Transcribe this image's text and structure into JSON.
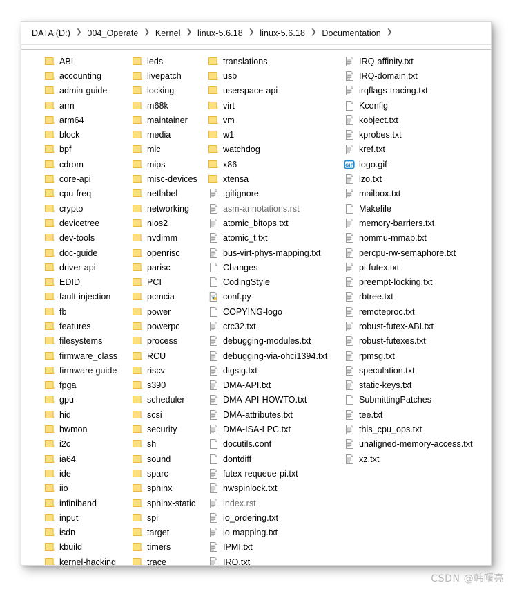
{
  "window": {
    "breadcrumb_separator": "❯",
    "breadcrumb": [
      "DATA (D:)",
      "004_Operate",
      "Kernel",
      "linux-5.6.18",
      "linux-5.6.18",
      "Documentation"
    ]
  },
  "colors": {
    "folder_fill": "#fcdf7f",
    "folder_edge": "#e8b93a",
    "doc_fill": "#ffffff",
    "doc_edge": "#9a9a9a",
    "txt_line": "#8f8f8f",
    "gif_blue": "#1a8ad4",
    "python_blue": "#3b6e9e",
    "python_yellow": "#f4c430",
    "watermark": "#b8b8b8",
    "text": "#000000",
    "dim_text": "#6e6e6e"
  },
  "columns": [
    {
      "id": "col-1",
      "items": [
        {
          "name": "ABI",
          "icon": "folder-icon"
        },
        {
          "name": "accounting",
          "icon": "folder-icon"
        },
        {
          "name": "admin-guide",
          "icon": "folder-icon"
        },
        {
          "name": "arm",
          "icon": "folder-icon"
        },
        {
          "name": "arm64",
          "icon": "folder-icon"
        },
        {
          "name": "block",
          "icon": "folder-icon"
        },
        {
          "name": "bpf",
          "icon": "folder-icon"
        },
        {
          "name": "cdrom",
          "icon": "folder-icon"
        },
        {
          "name": "core-api",
          "icon": "folder-icon"
        },
        {
          "name": "cpu-freq",
          "icon": "folder-icon"
        },
        {
          "name": "crypto",
          "icon": "folder-icon"
        },
        {
          "name": "devicetree",
          "icon": "folder-icon"
        },
        {
          "name": "dev-tools",
          "icon": "folder-icon"
        },
        {
          "name": "doc-guide",
          "icon": "folder-icon"
        },
        {
          "name": "driver-api",
          "icon": "folder-icon"
        },
        {
          "name": "EDID",
          "icon": "folder-icon"
        },
        {
          "name": "fault-injection",
          "icon": "folder-icon"
        },
        {
          "name": "fb",
          "icon": "folder-icon"
        },
        {
          "name": "features",
          "icon": "folder-icon"
        },
        {
          "name": "filesystems",
          "icon": "folder-icon"
        },
        {
          "name": "firmware_class",
          "icon": "folder-icon"
        },
        {
          "name": "firmware-guide",
          "icon": "folder-icon"
        },
        {
          "name": "fpga",
          "icon": "folder-icon"
        },
        {
          "name": "gpu",
          "icon": "folder-icon"
        },
        {
          "name": "hid",
          "icon": "folder-icon"
        },
        {
          "name": "hwmon",
          "icon": "folder-icon"
        },
        {
          "name": "i2c",
          "icon": "folder-icon"
        },
        {
          "name": "ia64",
          "icon": "folder-icon"
        },
        {
          "name": "ide",
          "icon": "folder-icon"
        },
        {
          "name": "iio",
          "icon": "folder-icon"
        },
        {
          "name": "infiniband",
          "icon": "folder-icon"
        },
        {
          "name": "input",
          "icon": "folder-icon"
        },
        {
          "name": "isdn",
          "icon": "folder-icon"
        },
        {
          "name": "kbuild",
          "icon": "folder-icon"
        },
        {
          "name": "kernel-hacking",
          "icon": "folder-icon"
        }
      ]
    },
    {
      "id": "col-2",
      "items": [
        {
          "name": "leds",
          "icon": "folder-icon"
        },
        {
          "name": "livepatch",
          "icon": "folder-icon"
        },
        {
          "name": "locking",
          "icon": "folder-icon"
        },
        {
          "name": "m68k",
          "icon": "folder-icon"
        },
        {
          "name": "maintainer",
          "icon": "folder-icon"
        },
        {
          "name": "media",
          "icon": "folder-icon"
        },
        {
          "name": "mic",
          "icon": "folder-icon"
        },
        {
          "name": "mips",
          "icon": "folder-icon"
        },
        {
          "name": "misc-devices",
          "icon": "folder-icon"
        },
        {
          "name": "netlabel",
          "icon": "folder-icon"
        },
        {
          "name": "networking",
          "icon": "folder-icon"
        },
        {
          "name": "nios2",
          "icon": "folder-icon"
        },
        {
          "name": "nvdimm",
          "icon": "folder-icon"
        },
        {
          "name": "openrisc",
          "icon": "folder-icon"
        },
        {
          "name": "parisc",
          "icon": "folder-icon"
        },
        {
          "name": "PCI",
          "icon": "folder-icon"
        },
        {
          "name": "pcmcia",
          "icon": "folder-icon"
        },
        {
          "name": "power",
          "icon": "folder-icon"
        },
        {
          "name": "powerpc",
          "icon": "folder-icon"
        },
        {
          "name": "process",
          "icon": "folder-icon"
        },
        {
          "name": "RCU",
          "icon": "folder-icon"
        },
        {
          "name": "riscv",
          "icon": "folder-icon"
        },
        {
          "name": "s390",
          "icon": "folder-icon"
        },
        {
          "name": "scheduler",
          "icon": "folder-icon"
        },
        {
          "name": "scsi",
          "icon": "folder-icon"
        },
        {
          "name": "security",
          "icon": "folder-icon"
        },
        {
          "name": "sh",
          "icon": "folder-icon"
        },
        {
          "name": "sound",
          "icon": "folder-icon"
        },
        {
          "name": "sparc",
          "icon": "folder-icon"
        },
        {
          "name": "sphinx",
          "icon": "folder-icon"
        },
        {
          "name": "sphinx-static",
          "icon": "folder-icon"
        },
        {
          "name": "spi",
          "icon": "folder-icon"
        },
        {
          "name": "target",
          "icon": "folder-icon"
        },
        {
          "name": "timers",
          "icon": "folder-icon"
        },
        {
          "name": "trace",
          "icon": "folder-icon"
        }
      ]
    },
    {
      "id": "col-3",
      "items": [
        {
          "name": "translations",
          "icon": "folder-icon"
        },
        {
          "name": "usb",
          "icon": "folder-icon"
        },
        {
          "name": "userspace-api",
          "icon": "folder-icon"
        },
        {
          "name": "virt",
          "icon": "folder-icon"
        },
        {
          "name": "vm",
          "icon": "folder-icon"
        },
        {
          "name": "w1",
          "icon": "folder-icon"
        },
        {
          "name": "watchdog",
          "icon": "folder-icon"
        },
        {
          "name": "x86",
          "icon": "folder-icon"
        },
        {
          "name": "xtensa",
          "icon": "folder-icon"
        },
        {
          "name": ".gitignore",
          "icon": "text-file-icon"
        },
        {
          "name": "asm-annotations.rst",
          "icon": "text-file-icon",
          "dim": true
        },
        {
          "name": "atomic_bitops.txt",
          "icon": "text-file-icon"
        },
        {
          "name": "atomic_t.txt",
          "icon": "text-file-icon"
        },
        {
          "name": "bus-virt-phys-mapping.txt",
          "icon": "text-file-icon"
        },
        {
          "name": "Changes",
          "icon": "blank-file-icon"
        },
        {
          "name": "CodingStyle",
          "icon": "blank-file-icon"
        },
        {
          "name": "conf.py",
          "icon": "python-file-icon"
        },
        {
          "name": "COPYING-logo",
          "icon": "blank-file-icon"
        },
        {
          "name": "crc32.txt",
          "icon": "text-file-icon"
        },
        {
          "name": "debugging-modules.txt",
          "icon": "text-file-icon"
        },
        {
          "name": "debugging-via-ohci1394.txt",
          "icon": "text-file-icon"
        },
        {
          "name": "digsig.txt",
          "icon": "text-file-icon"
        },
        {
          "name": "DMA-API.txt",
          "icon": "text-file-icon"
        },
        {
          "name": "DMA-API-HOWTO.txt",
          "icon": "text-file-icon"
        },
        {
          "name": "DMA-attributes.txt",
          "icon": "text-file-icon"
        },
        {
          "name": "DMA-ISA-LPC.txt",
          "icon": "text-file-icon"
        },
        {
          "name": "docutils.conf",
          "icon": "blank-file-icon"
        },
        {
          "name": "dontdiff",
          "icon": "blank-file-icon"
        },
        {
          "name": "futex-requeue-pi.txt",
          "icon": "text-file-icon"
        },
        {
          "name": "hwspinlock.txt",
          "icon": "text-file-icon"
        },
        {
          "name": "index.rst",
          "icon": "text-file-icon",
          "dim": true
        },
        {
          "name": "io_ordering.txt",
          "icon": "text-file-icon"
        },
        {
          "name": "io-mapping.txt",
          "icon": "text-file-icon"
        },
        {
          "name": "IPMI.txt",
          "icon": "text-file-icon"
        },
        {
          "name": "IRQ.txt",
          "icon": "text-file-icon"
        }
      ]
    },
    {
      "id": "col-4",
      "items": [
        {
          "name": "IRQ-affinity.txt",
          "icon": "text-file-icon"
        },
        {
          "name": "IRQ-domain.txt",
          "icon": "text-file-icon"
        },
        {
          "name": "irqflags-tracing.txt",
          "icon": "text-file-icon"
        },
        {
          "name": "Kconfig",
          "icon": "blank-file-icon"
        },
        {
          "name": "kobject.txt",
          "icon": "text-file-icon"
        },
        {
          "name": "kprobes.txt",
          "icon": "text-file-icon"
        },
        {
          "name": "kref.txt",
          "icon": "text-file-icon"
        },
        {
          "name": "logo.gif",
          "icon": "gif-file-icon"
        },
        {
          "name": "lzo.txt",
          "icon": "text-file-icon"
        },
        {
          "name": "mailbox.txt",
          "icon": "text-file-icon"
        },
        {
          "name": "Makefile",
          "icon": "blank-file-icon"
        },
        {
          "name": "memory-barriers.txt",
          "icon": "text-file-icon"
        },
        {
          "name": "nommu-mmap.txt",
          "icon": "text-file-icon"
        },
        {
          "name": "percpu-rw-semaphore.txt",
          "icon": "text-file-icon"
        },
        {
          "name": "pi-futex.txt",
          "icon": "text-file-icon"
        },
        {
          "name": "preempt-locking.txt",
          "icon": "text-file-icon"
        },
        {
          "name": "rbtree.txt",
          "icon": "text-file-icon"
        },
        {
          "name": "remoteproc.txt",
          "icon": "text-file-icon"
        },
        {
          "name": "robust-futex-ABI.txt",
          "icon": "text-file-icon"
        },
        {
          "name": "robust-futexes.txt",
          "icon": "text-file-icon"
        },
        {
          "name": "rpmsg.txt",
          "icon": "text-file-icon"
        },
        {
          "name": "speculation.txt",
          "icon": "text-file-icon"
        },
        {
          "name": "static-keys.txt",
          "icon": "text-file-icon"
        },
        {
          "name": "SubmittingPatches",
          "icon": "blank-file-icon"
        },
        {
          "name": "tee.txt",
          "icon": "text-file-icon"
        },
        {
          "name": "this_cpu_ops.txt",
          "icon": "text-file-icon"
        },
        {
          "name": "unaligned-memory-access.txt",
          "icon": "text-file-icon"
        },
        {
          "name": "xz.txt",
          "icon": "text-file-icon"
        }
      ]
    }
  ],
  "watermark": {
    "text": "CSDN @韩曙亮"
  }
}
